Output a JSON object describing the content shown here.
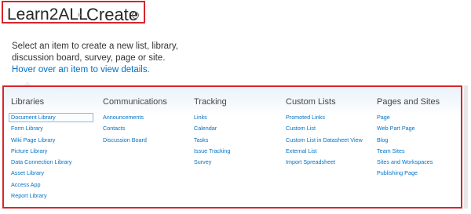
{
  "header": {
    "site_name": "Learn2ALL",
    "page_title": "Create"
  },
  "intro": {
    "line1": "Select an item to create a new list, library,",
    "line2": "discussion board, survey, page or site.",
    "hover_hint": "Hover over an item to view details."
  },
  "categories": [
    {
      "title": "Libraries",
      "items": [
        "Document Library",
        "Form Library",
        "Wiki Page Library",
        "Picture Library",
        "Data Connection Library",
        "Asset Library",
        "Access App",
        "Report Library"
      ]
    },
    {
      "title": "Communications",
      "items": [
        "Announcements",
        "Contacts",
        "Discussion Board"
      ]
    },
    {
      "title": "Tracking",
      "items": [
        "Links",
        "Calendar",
        "Tasks",
        "Issue Tracking",
        "Survey"
      ]
    },
    {
      "title": "Custom Lists",
      "items": [
        "Promoted Links",
        "Custom List",
        "Custom List in Datasheet View",
        "External List",
        "Import Spreadsheet"
      ]
    },
    {
      "title": "Pages and Sites",
      "items": [
        "Page",
        "Web Part Page",
        "Blog",
        "Team Sites",
        "Sites and Workspaces",
        "Publishing Page"
      ]
    }
  ],
  "colors": {
    "accent": "#0072c6",
    "highlight_border": "#d9242b"
  }
}
